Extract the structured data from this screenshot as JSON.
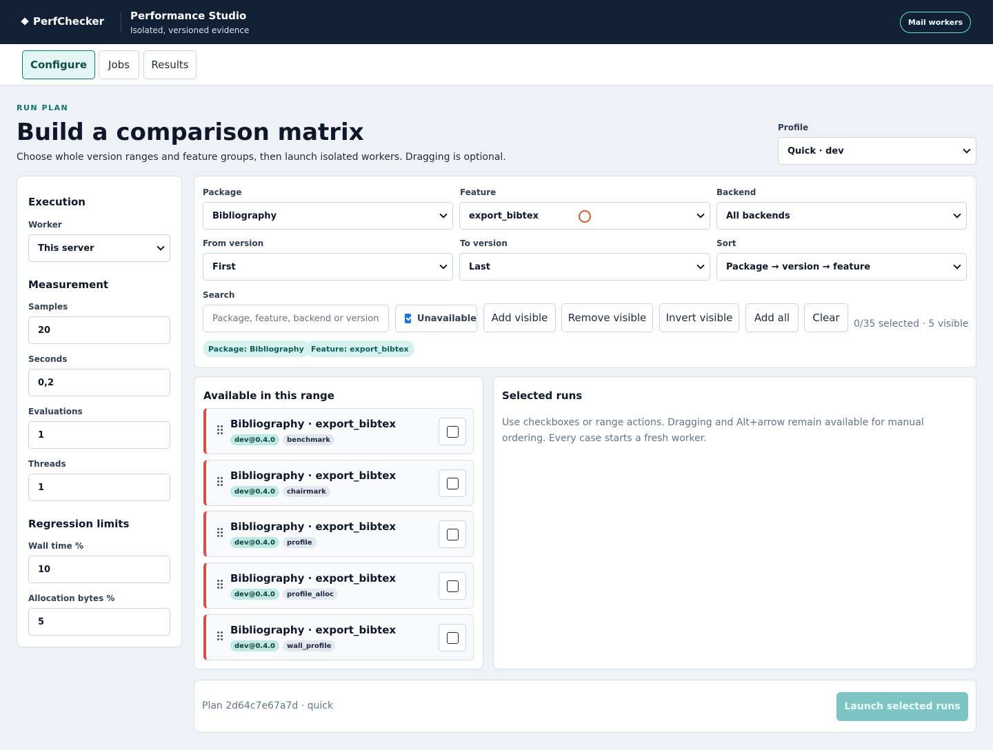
{
  "header": {
    "brand": "PerfChecker",
    "studio_title": "Performance Studio",
    "studio_subtitle": "Isolated, versioned evidence",
    "mail_button": "Mail workers"
  },
  "tabs": [
    {
      "label": "Configure",
      "active": true
    },
    {
      "label": "Jobs",
      "active": false
    },
    {
      "label": "Results",
      "active": false
    }
  ],
  "page": {
    "eyebrow": "RUN PLAN",
    "title": "Build a comparison matrix",
    "subtitle": "Choose whole version ranges and feature groups, then launch isolated workers. Dragging is optional.",
    "profile_label": "Profile",
    "profile_value": "Quick · dev"
  },
  "execution": {
    "section": "Execution",
    "worker_label": "Worker",
    "worker_value": "This server",
    "measurement_section": "Measurement",
    "samples_label": "Samples",
    "samples_value": "20",
    "seconds_label": "Seconds",
    "seconds_value": "0,2",
    "evaluations_label": "Evaluations",
    "evaluations_value": "1",
    "threads_label": "Threads",
    "threads_value": "1",
    "regression_section": "Regression limits",
    "wall_label": "Wall time %",
    "wall_value": "10",
    "alloc_label": "Allocation bytes %",
    "alloc_value": "5"
  },
  "filters": {
    "package_label": "Package",
    "package_value": "Bibliography",
    "feature_label": "Feature",
    "feature_value": "export_bibtex",
    "backend_label": "Backend",
    "backend_value": "All backends",
    "from_label": "From version",
    "from_value": "First",
    "to_label": "To version",
    "to_value": "Last",
    "sort_label": "Sort",
    "sort_value": "Package → version → feature",
    "search_label": "Search",
    "search_placeholder": "Package, feature, backend or version",
    "unavailable_label": "Unavailable",
    "unavailable_checked": true,
    "add_visible": "Add visible",
    "remove_visible": "Remove visible",
    "invert_visible": "Invert visible",
    "add_all": "Add all",
    "clear": "Clear",
    "selection_status": "0/35 selected · 5 visible",
    "chips": [
      "Package: Bibliography",
      "Feature: export_bibtex"
    ]
  },
  "available": {
    "title": "Available in this range",
    "runs": [
      {
        "title": "Bibliography · export_bibtex",
        "version": "dev@0.4.0",
        "backend": "benchmark"
      },
      {
        "title": "Bibliography · export_bibtex",
        "version": "dev@0.4.0",
        "backend": "chairmark"
      },
      {
        "title": "Bibliography · export_bibtex",
        "version": "dev@0.4.0",
        "backend": "profile"
      },
      {
        "title": "Bibliography · export_bibtex",
        "version": "dev@0.4.0",
        "backend": "profile_alloc"
      },
      {
        "title": "Bibliography · export_bibtex",
        "version": "dev@0.4.0",
        "backend": "wall_profile"
      }
    ]
  },
  "selected": {
    "title": "Selected runs",
    "hint": "Use checkboxes or range actions. Dragging and Alt+arrow remain available for manual ordering. Every case starts a fresh worker."
  },
  "footer": {
    "plan": "Plan 2d64c7e67a7d · quick",
    "launch": "Launch selected runs"
  },
  "colors": {
    "header_bg": "#122036",
    "accent": "#0f766e",
    "run_border": "#dc4a4a",
    "launch_bg": "#7fc4c4"
  }
}
